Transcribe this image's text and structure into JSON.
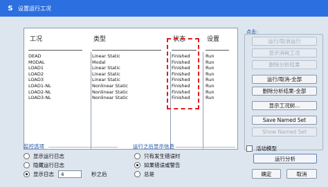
{
  "window": {
    "title": "设置运行工况",
    "logo": "S"
  },
  "case_table": {
    "columns": {
      "case": "工况",
      "type": "类型",
      "status": "状态",
      "action": "设置"
    },
    "rows": [
      {
        "case": "DEAD",
        "type": "Linear Static",
        "status": "Finished",
        "action": "Run"
      },
      {
        "case": "MODAL",
        "type": "Modal",
        "status": "Finished",
        "action": "Run"
      },
      {
        "case": "LOAD1",
        "type": "Linear Static",
        "status": "Finished",
        "action": "Run"
      },
      {
        "case": "LOAD2",
        "type": "Linear Static",
        "status": "Finished",
        "action": "Run"
      },
      {
        "case": "LOAD3",
        "type": "Linear Static",
        "status": "Finished",
        "action": "Run"
      },
      {
        "case": "LOAD1-NL",
        "type": "Nonlinear Static",
        "status": "Finished",
        "action": "Run"
      },
      {
        "case": "LOAD2-NL",
        "type": "Nonlinear Static",
        "status": "Finished",
        "action": "Run"
      },
      {
        "case": "LOAD3-NL",
        "type": "Nonlinear Static",
        "status": "Finished",
        "action": "Run"
      }
    ]
  },
  "click_panel": {
    "label": "点击:",
    "buttons": [
      {
        "label": "运行/取消运行",
        "enabled": false
      },
      {
        "label": "显示消耗工况",
        "enabled": false
      },
      {
        "label": "删除分析结果",
        "enabled": false
      },
      {
        "label": "运行/取消-全部",
        "enabled": true
      },
      {
        "label": "删除分析结果-全部",
        "enabled": true
      },
      {
        "label": "显示工况树...",
        "enabled": true
      },
      {
        "label": "Save Named Set",
        "enabled": true
      },
      {
        "label": "Show Named Set",
        "enabled": false
      }
    ]
  },
  "monitor": {
    "label": "监控选项",
    "options": [
      {
        "label": "显示运行日志",
        "selected": false
      },
      {
        "label": "隐藏运行日志",
        "selected": false
      },
      {
        "label": "显示日志",
        "selected": true
      }
    ],
    "log_seconds": "4",
    "log_suffix": "秒之后"
  },
  "post_run": {
    "label": "运行之后显示信息",
    "options": [
      {
        "label": "只有发生错误时",
        "selected": false
      },
      {
        "label": "如果错误或警告",
        "selected": true
      },
      {
        "label": "总是",
        "selected": false
      }
    ]
  },
  "active_model": {
    "label": "活动模型",
    "checked": false
  },
  "actions": {
    "run": "运行分析",
    "ok": "确定",
    "cancel": "取消"
  }
}
